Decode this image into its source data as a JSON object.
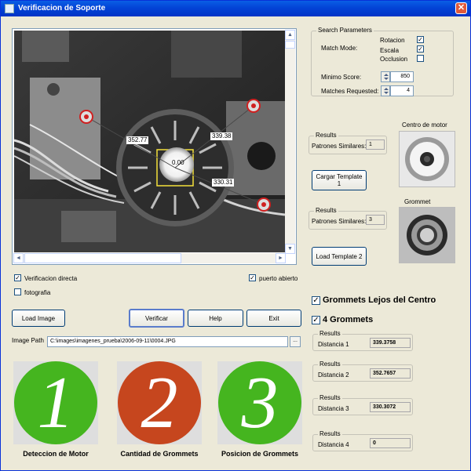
{
  "window": {
    "title": "Verificacion de Soporte",
    "close_glyph": "✕"
  },
  "viewer": {
    "labels": {
      "left": "352.77",
      "right": "339.38",
      "bottom": "330.31",
      "center": "0.00"
    },
    "scroll_left": "◄",
    "scroll_right": "►",
    "scroll_up": "▲",
    "scroll_down": "▼"
  },
  "checks": {
    "verificacion_directa": {
      "label": "Verificacion directa",
      "checked": true
    },
    "fotografia": {
      "label": "fotografia",
      "checked": false
    },
    "puerto_abierto": {
      "label": "puerto abierto",
      "checked": true
    }
  },
  "buttons": {
    "load_image": "Load Image",
    "verificar": "Verificar",
    "help": "Help",
    "exit": "Exit",
    "cargar_template_1_line1": "Cargar Template",
    "cargar_template_1_line2": "1",
    "load_template_2": "Load Template 2",
    "browse": "..."
  },
  "image_path": {
    "label": "Image Path",
    "value": "C:\\images\\imagenes_prueba\\2006-09-11\\0004.JPG"
  },
  "search_parameters": {
    "title": "Search Parameters",
    "match_mode_label": "Match Mode:",
    "rotacion": {
      "label": "Rotacion",
      "checked": true
    },
    "escala": {
      "label": "Escala",
      "checked": true
    },
    "occlusion": {
      "label": "Occlusion",
      "checked": false
    },
    "minimo_score_label": "Minimo Score:",
    "minimo_score_value": "850",
    "matches_requested_label": "Matches Requested:",
    "matches_requested_value": "4"
  },
  "results_1": {
    "title": "Results",
    "label": "Patrones Similares:",
    "value": "1"
  },
  "results_2": {
    "title": "Results",
    "label": "Patrones Similares:",
    "value": "3"
  },
  "templates": {
    "centro_label": "Centro de motor",
    "grommet_label": "Grommet"
  },
  "status": {
    "grommets_lejos": {
      "label": "Grommets Lejos del Centro",
      "checked": true
    },
    "four_grommets": {
      "label": "4 Grommets",
      "checked": true
    }
  },
  "distances": [
    {
      "title": "Results",
      "label": "Distancia 1",
      "value": "339.3758"
    },
    {
      "title": "Results",
      "label": "Distancia 2",
      "value": "352.7657"
    },
    {
      "title": "Results",
      "label": "Distancia 3",
      "value": "330.3072"
    },
    {
      "title": "Results",
      "label": "Distancia 4",
      "value": "0"
    }
  ],
  "stages": [
    {
      "number": "1",
      "label": "Deteccion de Motor",
      "color": "#45b51f"
    },
    {
      "number": "2",
      "label": "Cantidad de Grommets",
      "color": "#c6461e"
    },
    {
      "number": "3",
      "label": "Posicion de Grommets",
      "color": "#45b51f"
    }
  ],
  "check_glyph": "✓"
}
